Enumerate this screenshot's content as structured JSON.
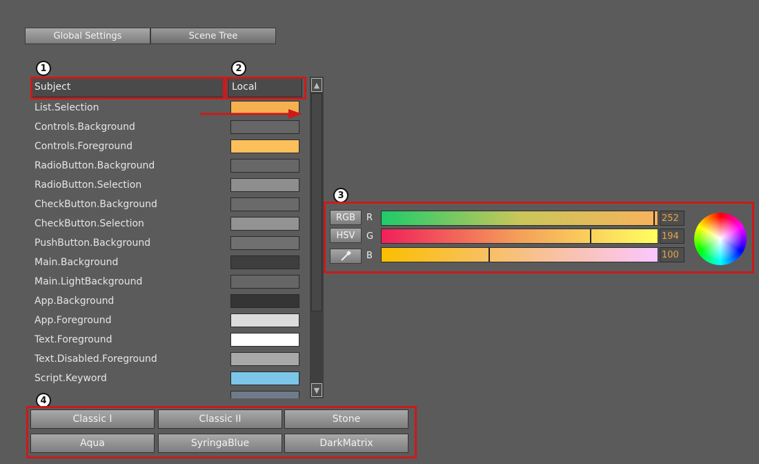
{
  "tabs": [
    {
      "label": "Global Settings"
    },
    {
      "label": "Scene Tree"
    }
  ],
  "annotations": [
    "1",
    "2",
    "3",
    "4"
  ],
  "table": {
    "headers": {
      "subject": "Subject",
      "local": "Local"
    },
    "rows": [
      {
        "label": "List.Selection",
        "color": "#f6b050"
      },
      {
        "label": "Controls.Background",
        "color": "#666666"
      },
      {
        "label": "Controls.Foreground",
        "color": "#fbbf5c"
      },
      {
        "label": "RadioButton.Background",
        "color": "#676767"
      },
      {
        "label": "RadioButton.Selection",
        "color": "#8e8e8e"
      },
      {
        "label": "CheckButton.Background",
        "color": "#6a6a6a"
      },
      {
        "label": "CheckButton.Selection",
        "color": "#939393"
      },
      {
        "label": "PushButton.Background",
        "color": "#707070"
      },
      {
        "label": "Main.Background",
        "color": "#3e3e3e"
      },
      {
        "label": "Main.LightBackground",
        "color": "#666666"
      },
      {
        "label": "App.Background",
        "color": "#353535"
      },
      {
        "label": "App.Foreground",
        "color": "#dcdcdc"
      },
      {
        "label": "Text.Foreground",
        "color": "#ffffff"
      },
      {
        "label": "Text.Disabled.Foreground",
        "color": "#a8a8a8"
      },
      {
        "label": "Script.Keyword",
        "color": "#7cc6e8"
      },
      {
        "label": "",
        "color": "#6f7b8a"
      }
    ]
  },
  "color_editor": {
    "modes": [
      "RGB",
      "HSV"
    ],
    "picker_icon": "eyedropper-icon",
    "channels": [
      {
        "label": "R",
        "value": "252",
        "fraction": 0.99
      },
      {
        "label": "G",
        "value": "194",
        "fraction": 0.76
      },
      {
        "label": "B",
        "value": "100",
        "fraction": 0.39
      }
    ]
  },
  "themes": [
    "Classic I",
    "Classic II",
    "Stone",
    "Aqua",
    "SyringaBlue",
    "DarkMatrix"
  ],
  "colors": {
    "annotation_red": "#cc1a1a",
    "background": "#5b5b5b",
    "value_text": "#e4a64a"
  }
}
